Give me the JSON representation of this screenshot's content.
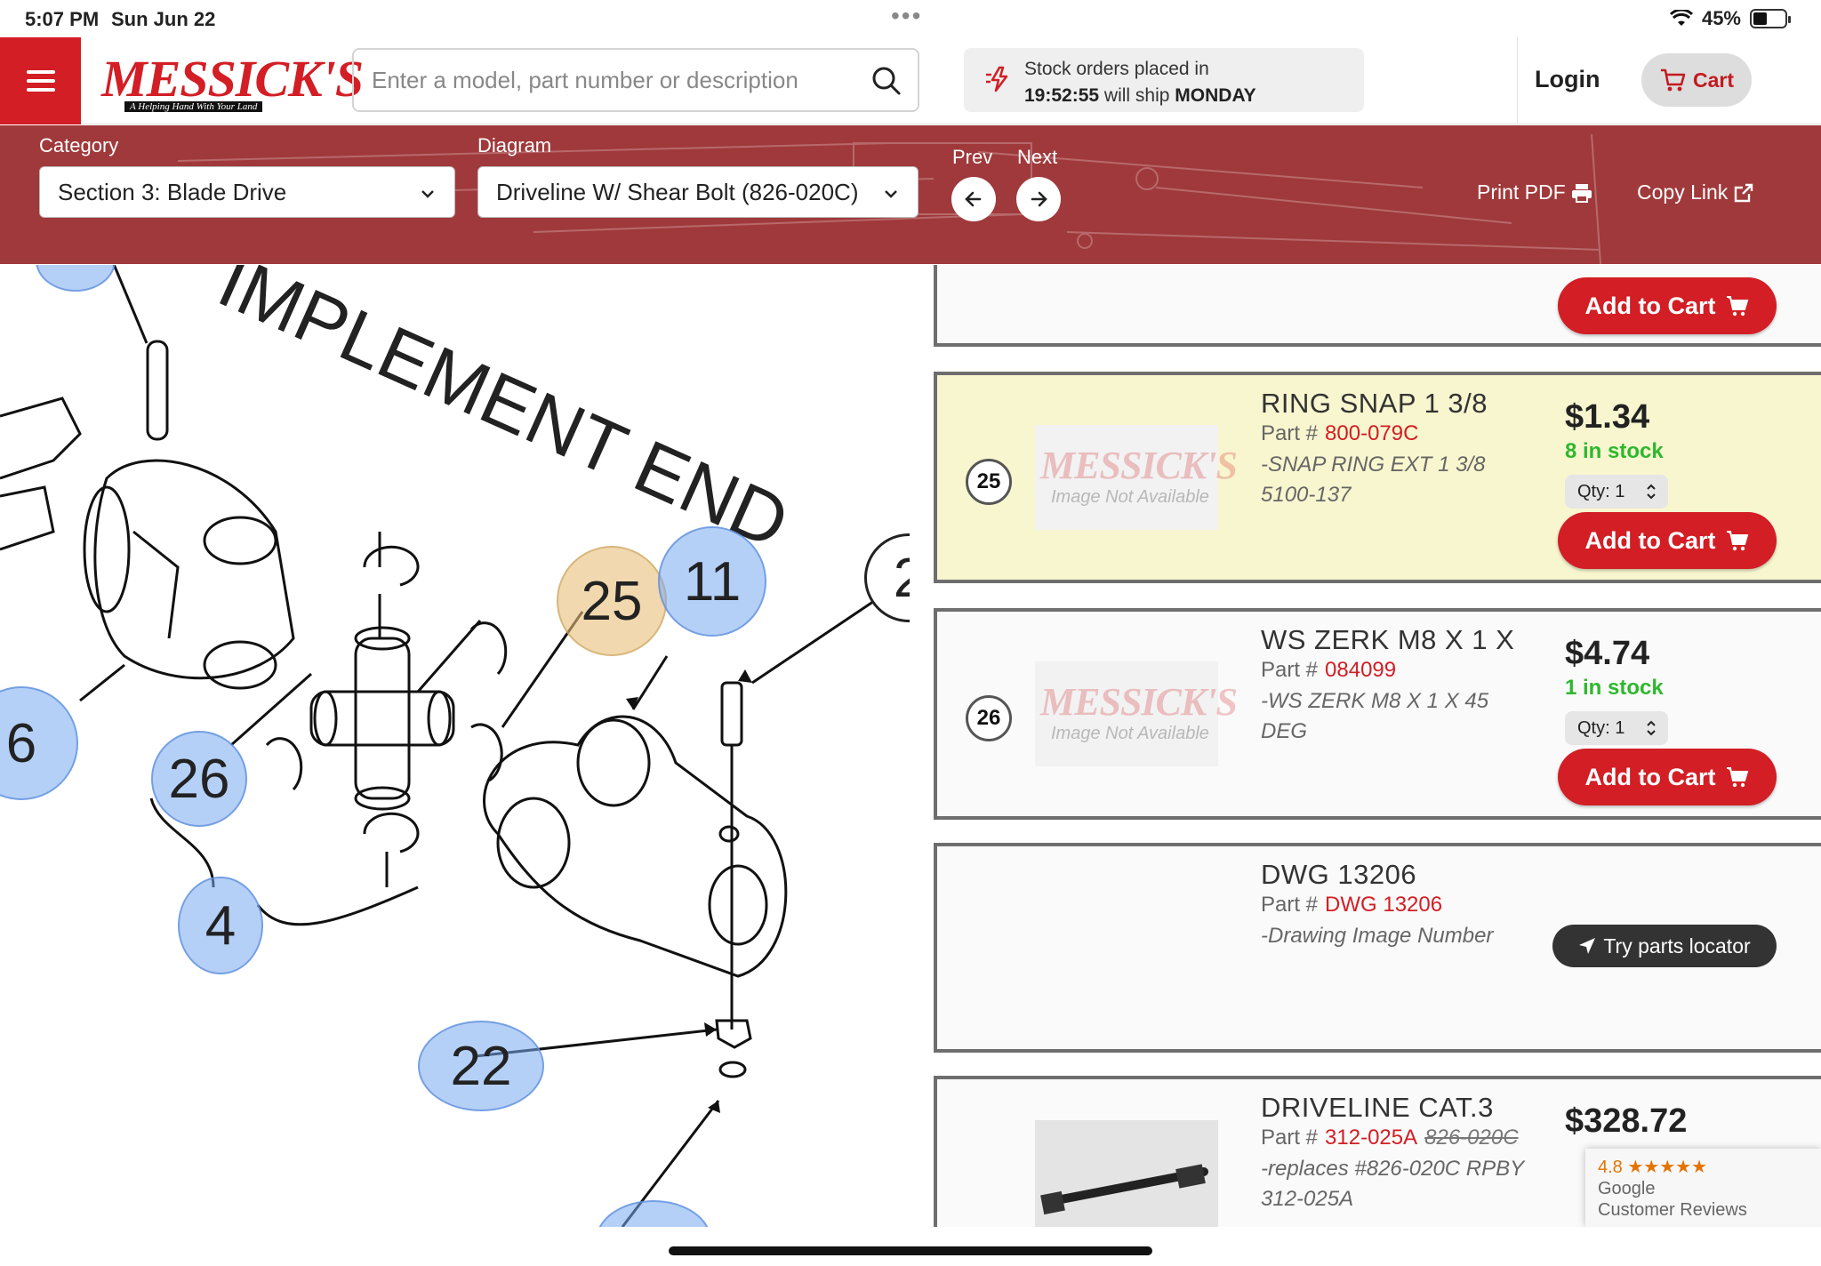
{
  "status_bar": {
    "time": "5:07 PM",
    "date": "Sun Jun 22",
    "battery": "45%",
    "battery_level": 0.45
  },
  "header": {
    "logo_text": "MESSICK'S",
    "logo_tagline": "A Helping Hand With Your Land",
    "search_placeholder": "Enter a model, part number or description",
    "stock_line1": "Stock orders placed in",
    "stock_countdown": "19:52:55",
    "stock_mid": "will ship",
    "stock_day": "MONDAY",
    "login": "Login",
    "cart": "Cart"
  },
  "toolbar": {
    "category_label": "Category",
    "category_value": "Section 3: Blade Drive",
    "diagram_label": "Diagram",
    "diagram_value": "Driveline W/ Shear Bolt (826-020C)",
    "prev": "Prev",
    "next": "Next",
    "print_pdf": "Print PDF",
    "copy_link": "Copy Link"
  },
  "diagram": {
    "heading_text": "IMPLEMENT END",
    "callouts": [
      "6",
      "26",
      "4",
      "25",
      "11",
      "22",
      "2"
    ]
  },
  "parts": [
    {
      "num": "25",
      "name": "RING SNAP 1 3/8",
      "part_label": "Part #",
      "part_no": "800-079C",
      "desc": "-SNAP RING EXT 1 3/8 5100-137",
      "price": "$1.34",
      "stock": "8 in stock",
      "qty": "Qty: 1",
      "add_to_cart": "Add to Cart",
      "img_placeholder": "Image Not Available"
    },
    {
      "num": "26",
      "name": "WS ZERK M8 X 1 X",
      "part_label": "Part #",
      "part_no": "084099",
      "desc": "-WS ZERK M8 X 1 X 45 DEG",
      "price": "$4.74",
      "stock": "1 in stock",
      "qty": "Qty: 1",
      "add_to_cart": "Add to Cart",
      "img_placeholder": "Image Not Available"
    },
    {
      "name": "DWG 13206",
      "part_label": "Part #",
      "part_no": "DWG 13206",
      "desc": "-Drawing Image Number",
      "locator": "Try parts locator"
    },
    {
      "name": "DRIVELINE CAT.3",
      "part_label": "Part #",
      "part_no": "312-025A",
      "old_part_no": "826-020C",
      "desc": "-replaces #826-020C RPBY 312-025A",
      "price": "$328.72"
    }
  ],
  "top_card": {
    "add_to_cart": "Add to Cart"
  },
  "reviews": {
    "rating": "4.8",
    "stars": "★★★★★",
    "line1": "Google",
    "line2": "Customer Reviews"
  },
  "colors": {
    "brand_red": "#d21e24",
    "toolbar_bg": "#a0393b",
    "highlight": "#f8f6cf",
    "stock_green": "#2eb82e"
  }
}
